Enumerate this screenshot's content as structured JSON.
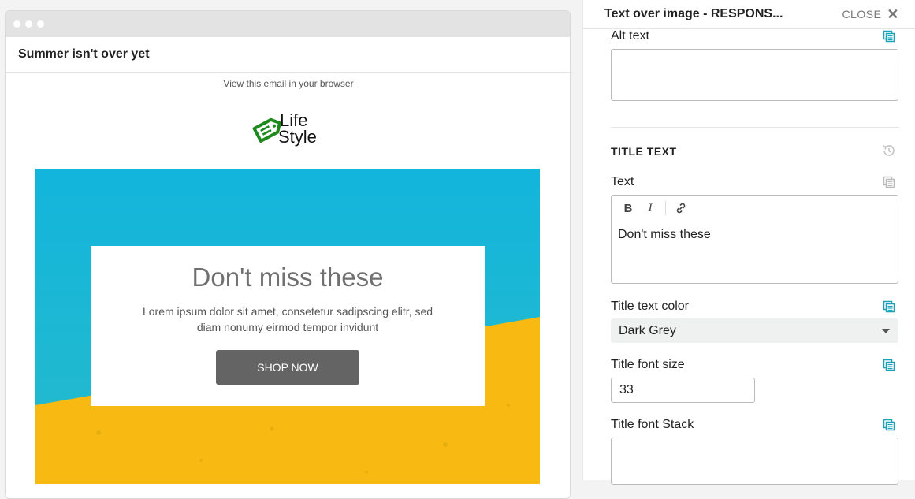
{
  "email": {
    "subject": "Summer isn't over yet",
    "view_in_browser": "View this email in your browser",
    "logo": {
      "line1": "Life",
      "line2": "Style",
      "color": "#1e8a1e"
    },
    "hero": {
      "title": "Don't miss these",
      "description": "Lorem ipsum dolor sit amet, consetetur sadipscing elitr, sed diam nonumy eirmod tempor invidunt",
      "button_label": "SHOP NOW",
      "sky_color": "#19b6d4",
      "sand_color": "#f7b912"
    }
  },
  "panel": {
    "title": "Text over image - RESPONS...",
    "close_label": "CLOSE",
    "alt_text": {
      "label": "Alt text",
      "value": ""
    },
    "section_title": "TITLE TEXT",
    "text": {
      "label": "Text",
      "value": "Don't miss these",
      "toolbar": {
        "bold": "B",
        "italic": "I"
      }
    },
    "title_color": {
      "label": "Title text color",
      "value": "Dark Grey"
    },
    "title_font_size": {
      "label": "Title font size",
      "value": "33"
    },
    "title_font_stack": {
      "label": "Title font Stack",
      "value": ""
    },
    "accent_color": "#1aa3b8"
  }
}
